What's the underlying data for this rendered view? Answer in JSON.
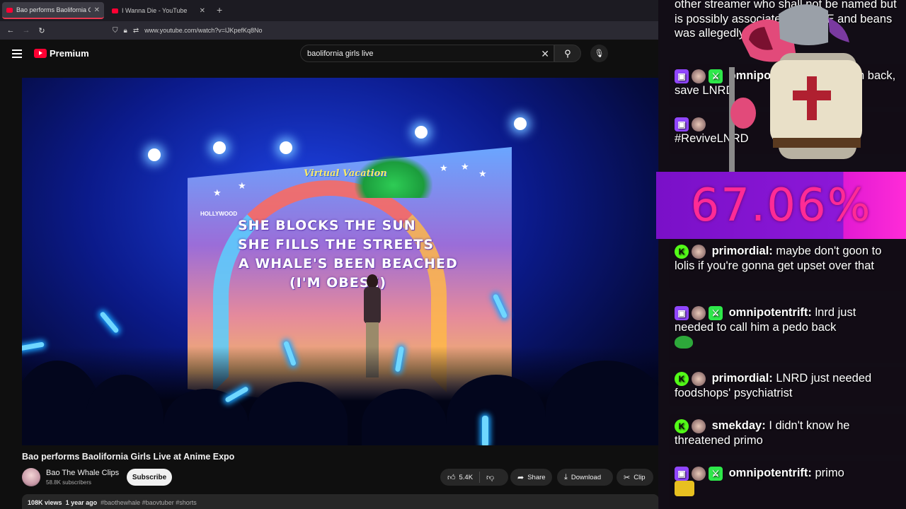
{
  "browser": {
    "tabs": [
      {
        "title": "Bao performs Baolifornia Girls Live at Anime Expo",
        "active": true
      },
      {
        "title": "I Wanna Die - YouTube",
        "active": false
      }
    ],
    "url": "www.youtube.com/watch?v=lJKpefKq8No"
  },
  "youtube": {
    "brand": "Premium",
    "search_value": "baolifornia girls live",
    "video": {
      "title": "Bao performs Baolifornia Girls Live at Anime Expo",
      "lyrics": [
        "SHE BLOCKS THE SUN",
        "SHE FILLS THE STREETS",
        "A WHALE'S BEEN BEACHED",
        "(I'M OBESE)"
      ],
      "screen_logo": "Virtual Vacation",
      "sign": "HOLLYWOOD"
    },
    "channel": {
      "name": "Bao The Whale Clips",
      "subscribers": "58.8K subscribers"
    },
    "subscribe_label": "Subscribe",
    "actions": {
      "likes": "5.4K",
      "share": "Share",
      "download": "Download",
      "clip": "Clip"
    },
    "description": {
      "views": "108K views",
      "age": "1 year ago",
      "tags": "#baothewhale #baovtuber #shorts"
    }
  },
  "overlay": {
    "percentage": "67.06%",
    "chat": [
      {
        "id": "c0",
        "text": "other streamer who shall not be named but is possibly associated with ICE and beans was allegedly"
      },
      {
        "id": "c1",
        "user": "omnipotentrift:",
        "text": "Bring him back, save LNRD"
      },
      {
        "id": "c2",
        "text": "#ReviveLNRD"
      },
      {
        "id": "c3",
        "user": "primordial:",
        "text": "maybe don't goon to lolis if you're gonna get upset over that"
      },
      {
        "id": "c4",
        "user": "omnipotentrift:",
        "text": "lnrd just needed to call him a pedo back"
      },
      {
        "id": "c5",
        "user": "primordial:",
        "text": "LNRD just needed foodshops' psychiatrist"
      },
      {
        "id": "c6",
        "user": "smekday:",
        "text": "I didn't know he threatened primo"
      },
      {
        "id": "c7",
        "user": "omnipotentrift:",
        "text": "primo"
      }
    ]
  },
  "colors": {
    "accent": "#ff0033",
    "twitch": "#9146ff",
    "kick": "#53fc18",
    "overlay_bar": "#8c18d8"
  }
}
